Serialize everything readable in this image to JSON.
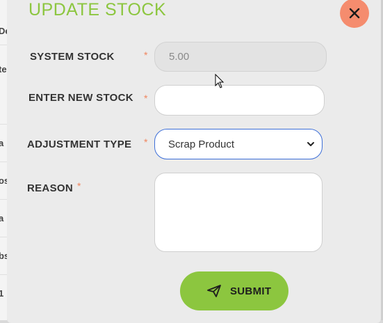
{
  "background": {
    "fragments": [
      "De",
      "te",
      "a",
      "os",
      "a",
      "bs",
      "1"
    ]
  },
  "modal": {
    "title": "UPDATE STOCK",
    "close_icon": "close-icon",
    "fields": {
      "system_stock": {
        "label": "SYSTEM STOCK",
        "required_mark": "*",
        "value": "5.00"
      },
      "new_stock": {
        "label": "ENTER NEW STOCK",
        "required_mark": "*",
        "value": ""
      },
      "adjustment_type": {
        "label": "ADJUSTMENT TYPE",
        "required_mark": "*",
        "selected": "Scrap Product"
      },
      "reason": {
        "label": "REASON",
        "required_mark": "*",
        "value": ""
      }
    },
    "submit": {
      "label": "SUBMIT",
      "icon": "send-icon"
    }
  },
  "colors": {
    "accent": "#8cc63f",
    "close": "#f58c6e",
    "required": "#f0865f",
    "focus_border": "#3d6fd8"
  }
}
